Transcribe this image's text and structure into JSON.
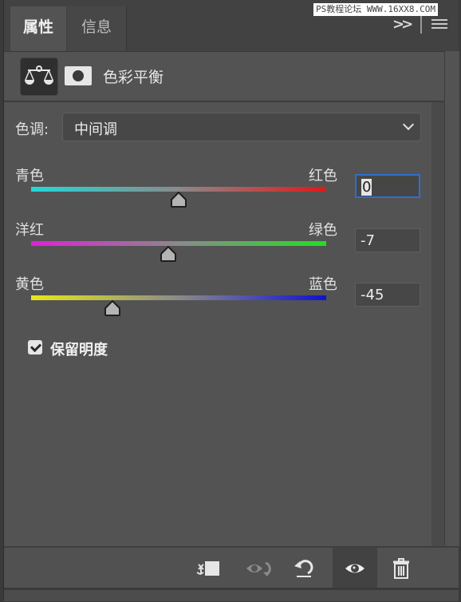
{
  "tabs": [
    {
      "label": "属性",
      "active": true
    },
    {
      "label": "信息",
      "active": false
    }
  ],
  "watermark": "PS教程论坛 WWW.16XX8.COM",
  "panel_menu": {
    "expand_icon": "double-chevron-right-icon",
    "menu_icon": "hamburger-menu-icon"
  },
  "adjustment": {
    "title": "色彩平衡",
    "icon": "balance-scale-icon",
    "mask_icon": "layer-mask-icon"
  },
  "tone": {
    "label": "色调:",
    "selected": "中间调"
  },
  "sliders": [
    {
      "left_label": "青色",
      "right_label": "红色",
      "value": "0",
      "min": -100,
      "max": 100,
      "left_color": "#22d8d8",
      "right_color": "#e01818",
      "focused": true
    },
    {
      "left_label": "洋红",
      "right_label": "绿色",
      "value": "-7",
      "min": -100,
      "max": 100,
      "left_color": "#e020d8",
      "right_color": "#20e020",
      "focused": false
    },
    {
      "left_label": "黄色",
      "right_label": "蓝色",
      "value": "-45",
      "min": -100,
      "max": 100,
      "left_color": "#e8e818",
      "right_color": "#1010d8",
      "focused": false
    }
  ],
  "preserve_luminosity": {
    "label": "保留明度",
    "checked": true
  },
  "footer": {
    "clip_icon": "clip-to-layer-icon",
    "view_previous_icon": "view-previous-state-icon",
    "reset_icon": "reset-icon",
    "visibility_icon": "eye-icon",
    "delete_icon": "trash-icon"
  }
}
